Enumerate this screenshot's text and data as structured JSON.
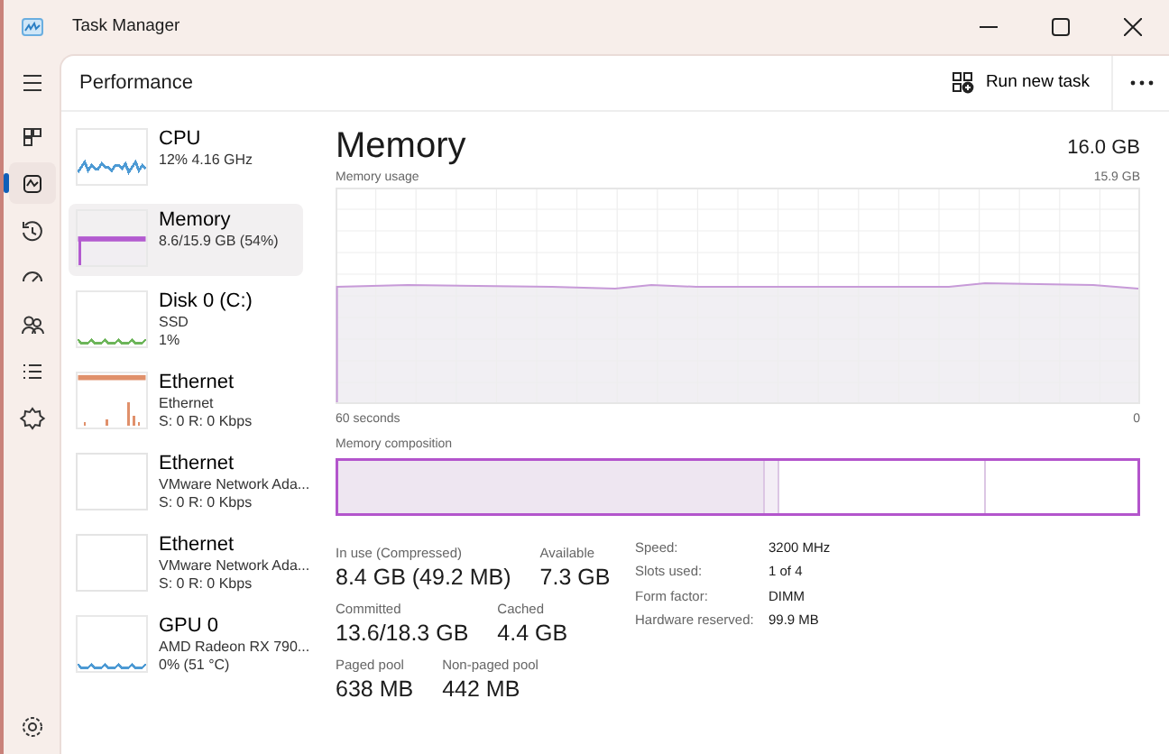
{
  "window": {
    "title": "Task Manager"
  },
  "nav": [
    {
      "kind": "menu",
      "selected": false
    },
    {
      "kind": "processes",
      "selected": false
    },
    {
      "kind": "performance",
      "selected": true
    },
    {
      "kind": "history",
      "selected": false
    },
    {
      "kind": "startup",
      "selected": false
    },
    {
      "kind": "users",
      "selected": false
    },
    {
      "kind": "details",
      "selected": false
    },
    {
      "kind": "services",
      "selected": false
    },
    {
      "kind": "settings",
      "selected": false
    }
  ],
  "header": {
    "title": "Performance",
    "action": "Run new task"
  },
  "resources": [
    {
      "name": "CPU",
      "lines": [
        "12%  4.16 GHz"
      ],
      "color": "#4d9ad4",
      "kind": "wave",
      "selected": false
    },
    {
      "name": "Memory",
      "lines": [
        "8.6/15.9 GB (54%)"
      ],
      "color": "#b35bd0",
      "kind": "fill",
      "selected": true
    },
    {
      "name": "Disk 0 (C:)",
      "lines": [
        "SSD",
        "1%"
      ],
      "color": "#6db55a",
      "kind": "low",
      "selected": false
    },
    {
      "name": "Ethernet",
      "lines": [
        "Ethernet",
        "S: 0 R: 0 Kbps"
      ],
      "color": "#e0906b",
      "kind": "spikes",
      "selected": false
    },
    {
      "name": "Ethernet",
      "lines": [
        "VMware Network Ada...",
        "S: 0 R: 0 Kbps"
      ],
      "kind": "flat",
      "selected": false
    },
    {
      "name": "Ethernet",
      "lines": [
        "VMware Network Ada...",
        "S: 0 R: 0 Kbps"
      ],
      "kind": "flat",
      "selected": false
    },
    {
      "name": "GPU 0",
      "lines": [
        "AMD Radeon RX 790...",
        "0% (51 °C)"
      ],
      "color": "#4d9ad4",
      "kind": "low",
      "selected": false
    }
  ],
  "detail": {
    "title": "Memory",
    "total": "16.0 GB",
    "usage_label": "Memory usage",
    "usage_max": "15.9 GB",
    "time_start": "60 seconds",
    "time_end": "0",
    "composition_label": "Memory composition",
    "stats": [
      [
        {
          "label": "In use (Compressed)",
          "value": "8.4 GB (49.2 MB)"
        },
        {
          "label": "Available",
          "value": "7.3 GB"
        }
      ],
      [
        {
          "label": "Committed",
          "value": "13.6/18.3 GB"
        },
        {
          "label": "Cached",
          "value": "4.4 GB"
        }
      ],
      [
        {
          "label": "Paged pool",
          "value": "638 MB"
        },
        {
          "label": "Non-paged pool",
          "value": "442 MB"
        }
      ]
    ],
    "properties": [
      {
        "label": "Speed:",
        "value": "3200 MHz"
      },
      {
        "label": "Slots used:",
        "value": "1 of 4"
      },
      {
        "label": "Form factor:",
        "value": "DIMM"
      },
      {
        "label": "Hardware reserved:",
        "value": "99.9 MB"
      }
    ]
  }
}
